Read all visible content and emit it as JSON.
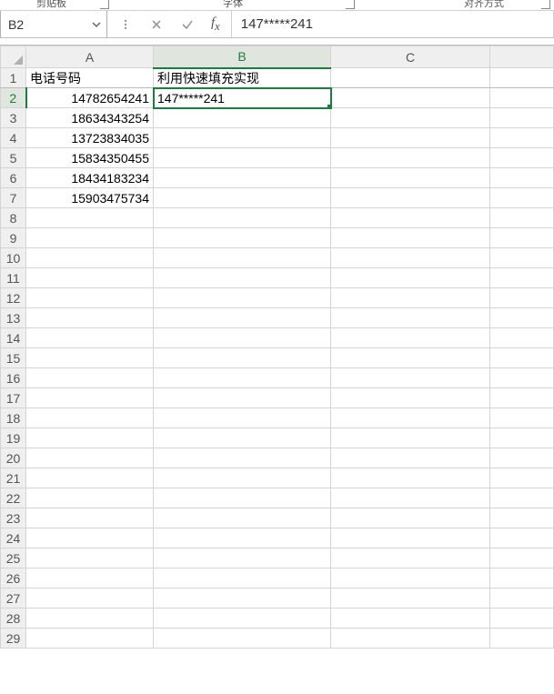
{
  "ribbon": {
    "group1": "剪贴板",
    "group2": "字体",
    "group3": "对齐方式"
  },
  "name_box": {
    "value": "B2"
  },
  "formula_bar": {
    "value": "147*****241"
  },
  "columns": [
    "A",
    "B",
    "C",
    ""
  ],
  "row_headers": [
    "1",
    "2",
    "3",
    "4",
    "5",
    "6",
    "7",
    "8",
    "9",
    "10",
    "11",
    "12",
    "13",
    "14",
    "15",
    "16",
    "17",
    "18",
    "19",
    "20",
    "21",
    "22",
    "23",
    "24",
    "25",
    "26",
    "27",
    "28",
    "29"
  ],
  "active_cell": "B2",
  "cells": {
    "A1": {
      "value": "电话号码",
      "type": "txt"
    },
    "B1": {
      "value": "利用快速填充实现",
      "type": "txt"
    },
    "A2": {
      "value": "14782654241",
      "type": "num"
    },
    "B2": {
      "value": "147*****241",
      "type": "txt"
    },
    "A3": {
      "value": "18634343254",
      "type": "num"
    },
    "A4": {
      "value": "13723834035",
      "type": "num"
    },
    "A5": {
      "value": "15834350455",
      "type": "num"
    },
    "A6": {
      "value": "18434183234",
      "type": "num"
    },
    "A7": {
      "value": "15903475734",
      "type": "num"
    }
  }
}
